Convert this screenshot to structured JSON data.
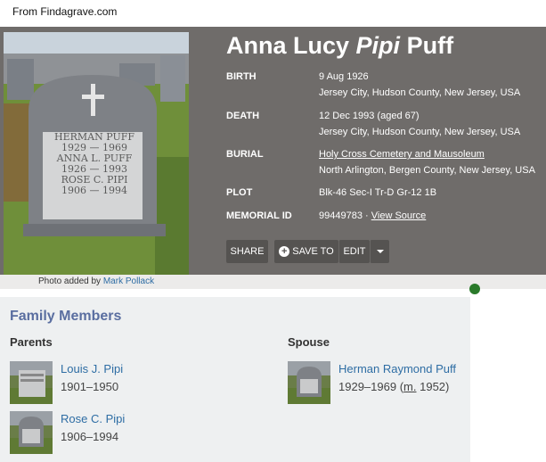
{
  "source_note": "From Findagrave.com",
  "memorial": {
    "name_first": "Anna Lucy",
    "name_maiden": "Pipi",
    "name_last": "Puff",
    "birth_label": "BIRTH",
    "birth_date": "9 Aug 1926",
    "birth_place": "Jersey City, Hudson County, New Jersey, USA",
    "death_label": "DEATH",
    "death_date": "12 Dec 1993 (aged 67)",
    "death_place": "Jersey City, Hudson County, New Jersey, USA",
    "burial_label": "BURIAL",
    "burial_cemetery": "Holy Cross Cemetery and Mausoleum",
    "burial_place": "North Arlington, Bergen County, New Jersey, USA",
    "plot_label": "PLOT",
    "plot_value": "Blk-46 Sec-I Tr-D Gr-12 1B",
    "memorial_id_label": "MEMORIAL ID",
    "memorial_id": "99449783",
    "memorial_id_sep": "·",
    "view_source": "View Source"
  },
  "gravestone": {
    "line1": "HERMAN PUFF",
    "line2": "1929 — 1969",
    "line3": "ANNA L. PUFF",
    "line4": "1926 — 1993",
    "line5": "ROSE C. PIPI",
    "line6": "1906 — 1994"
  },
  "photo_caption": {
    "prefix": "Photo added by",
    "author": "Mark Pollack"
  },
  "actions": {
    "share": "SHARE",
    "save_to": "SAVE TO",
    "edit": "EDIT"
  },
  "family": {
    "heading": "Family Members",
    "parents_label": "Parents",
    "spouse_label": "Spouse",
    "parents": [
      {
        "name": "Louis J. Pipi",
        "dates": "1901–1950"
      },
      {
        "name": "Rose C. Pipi",
        "dates": "1906–1994"
      }
    ],
    "spouse": {
      "name": "Herman Raymond Puff",
      "dates": "1929–1969",
      "marriage_prefix": "(",
      "marriage_abbr": "m.",
      "marriage_year": " 1952)"
    }
  },
  "colors": {
    "panel": "#6f6c6a",
    "link": "#2e6da4",
    "heading": "#5a6ea0",
    "family_bg": "#eef0f1"
  }
}
